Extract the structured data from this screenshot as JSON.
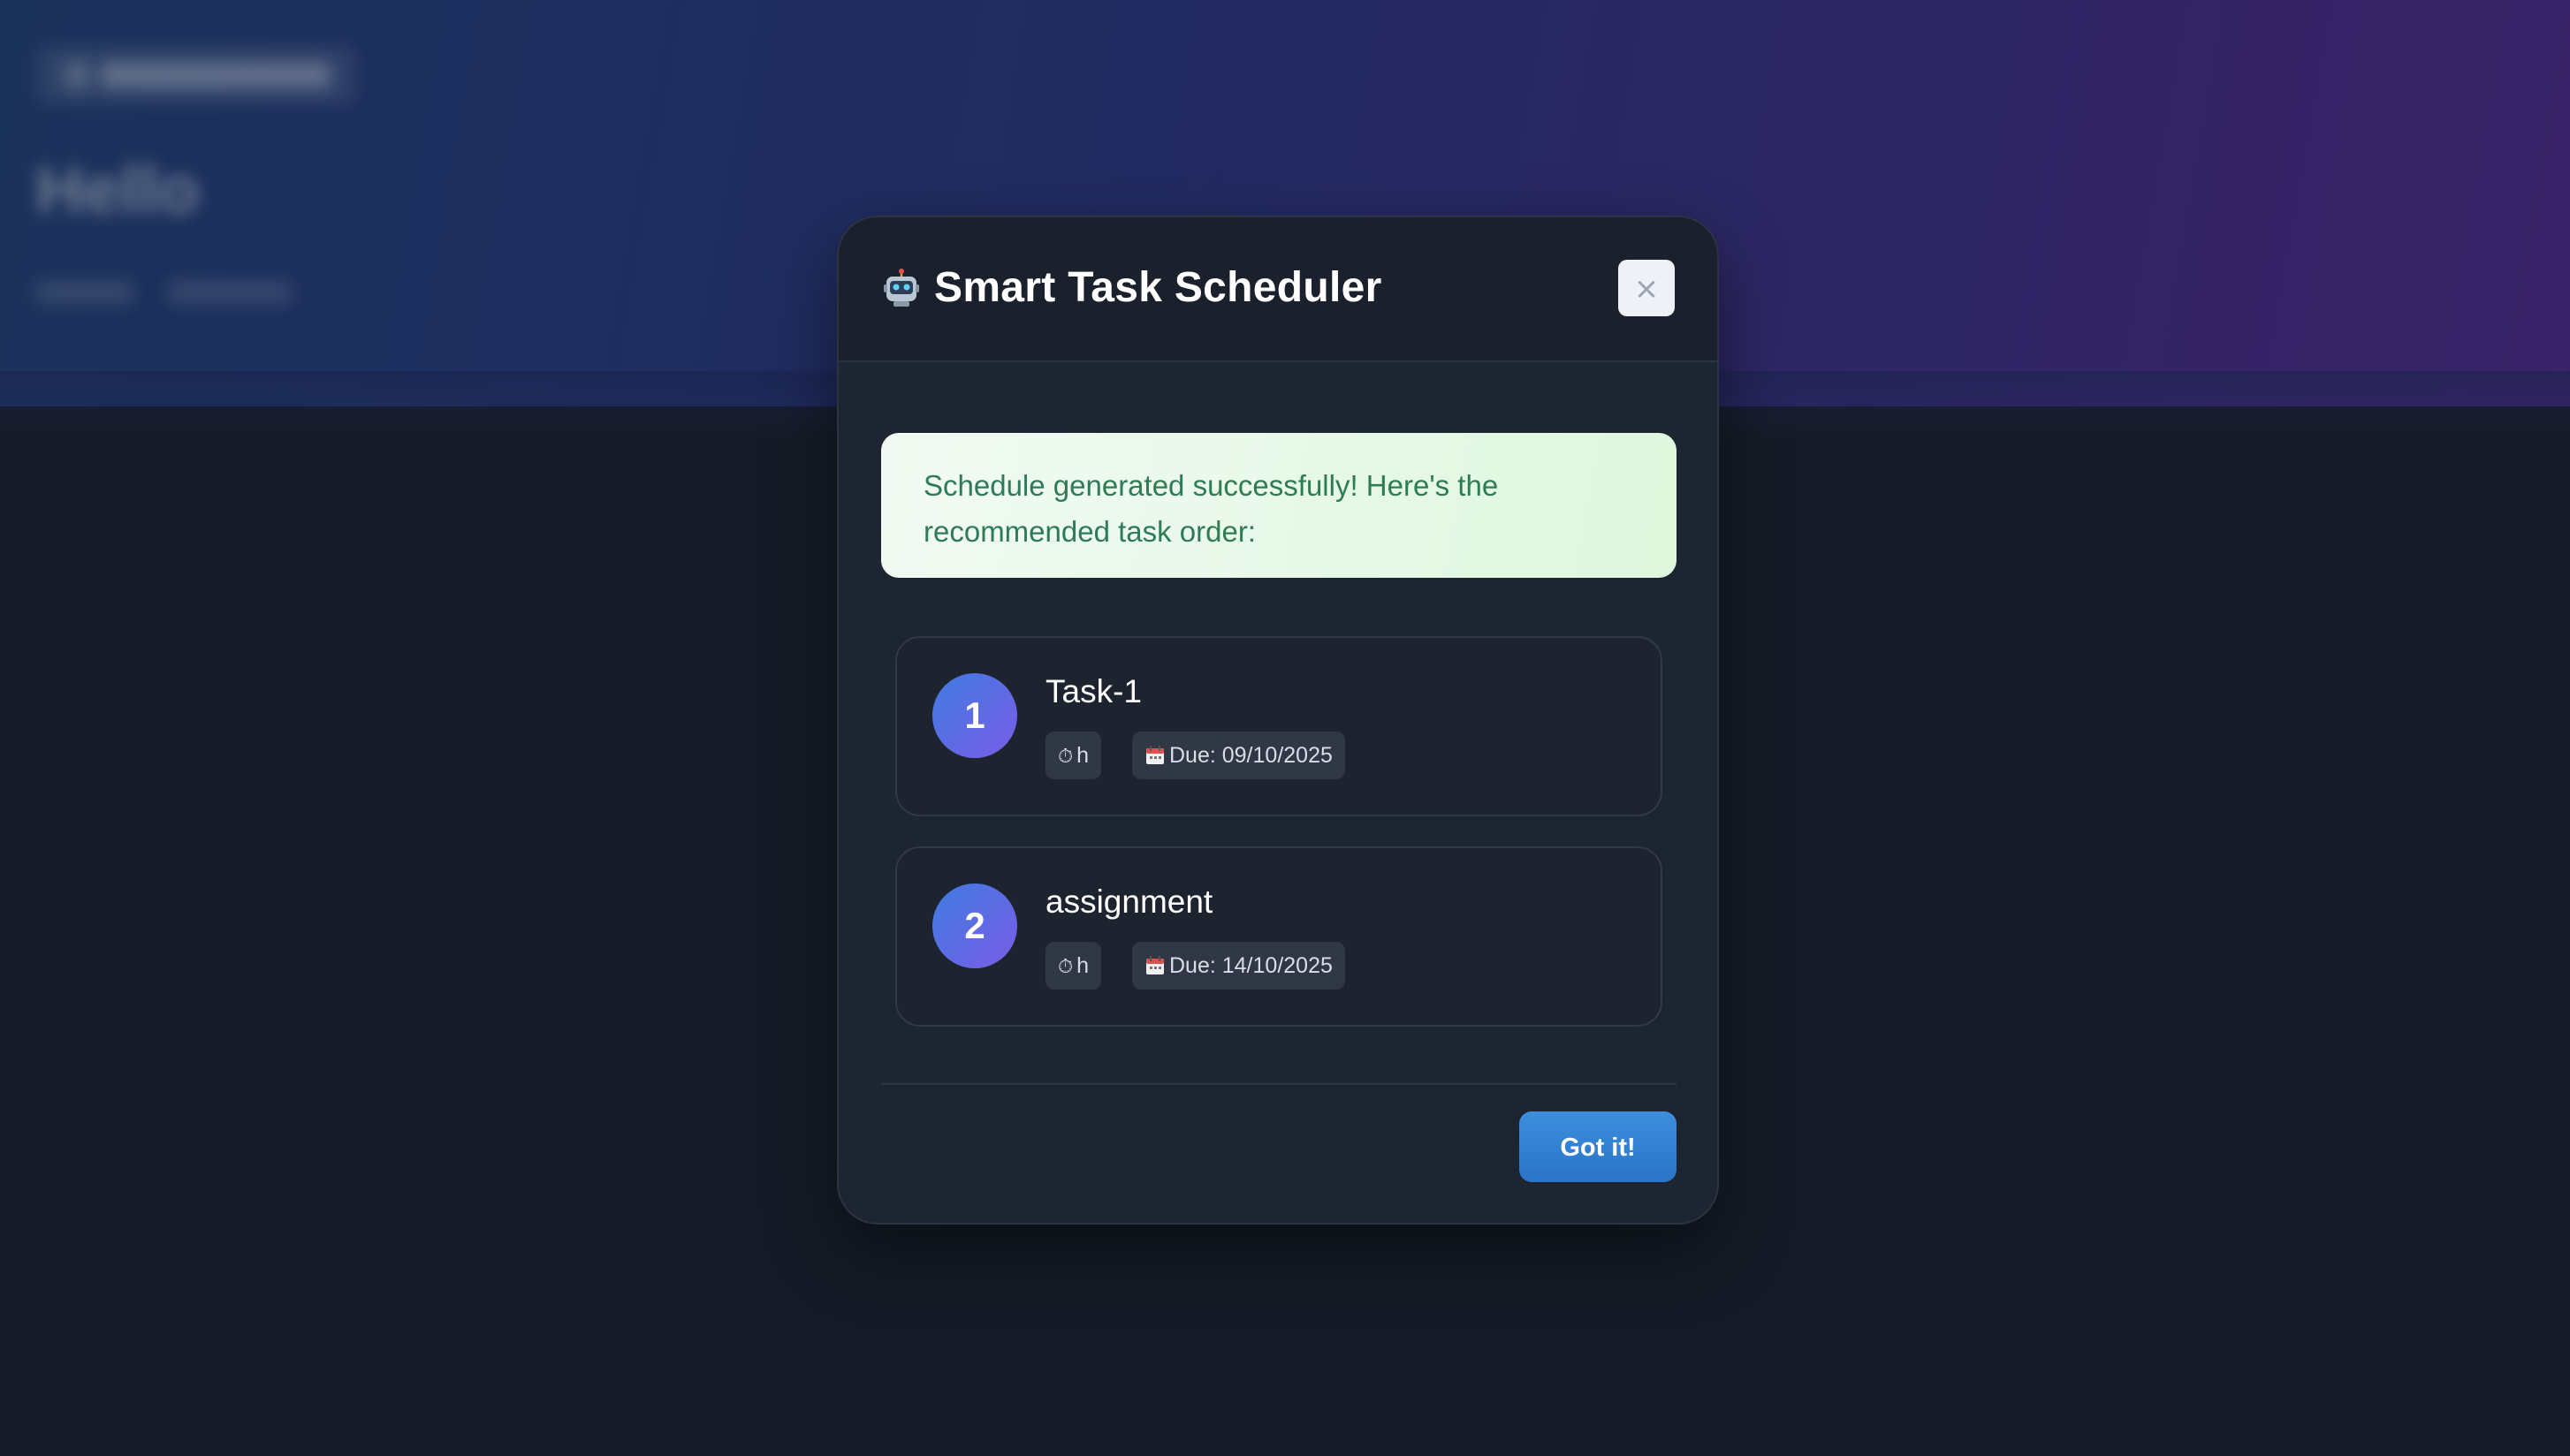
{
  "background": {
    "heading": "Hello"
  },
  "modal": {
    "title": "Smart Task Scheduler",
    "title_icon": "robot-icon",
    "close_label": "×",
    "success_message": "Schedule generated successfully! Here's the recommended task order:",
    "tasks": [
      {
        "rank": "1",
        "name": "Task-1",
        "duration": "h",
        "duration_icon": "stopwatch-icon",
        "due": "Due: 09/10/2025",
        "due_icon": "calendar-icon"
      },
      {
        "rank": "2",
        "name": "assignment",
        "duration": "h",
        "duration_icon": "stopwatch-icon",
        "due": "Due: 14/10/2025",
        "due_icon": "calendar-icon"
      }
    ],
    "confirm_label": "Got it!"
  },
  "colors": {
    "accent": "#3c8fdc",
    "success_text": "#2e7b55",
    "modal_bg": "#1e2532",
    "page_bg": "#181e2a"
  }
}
